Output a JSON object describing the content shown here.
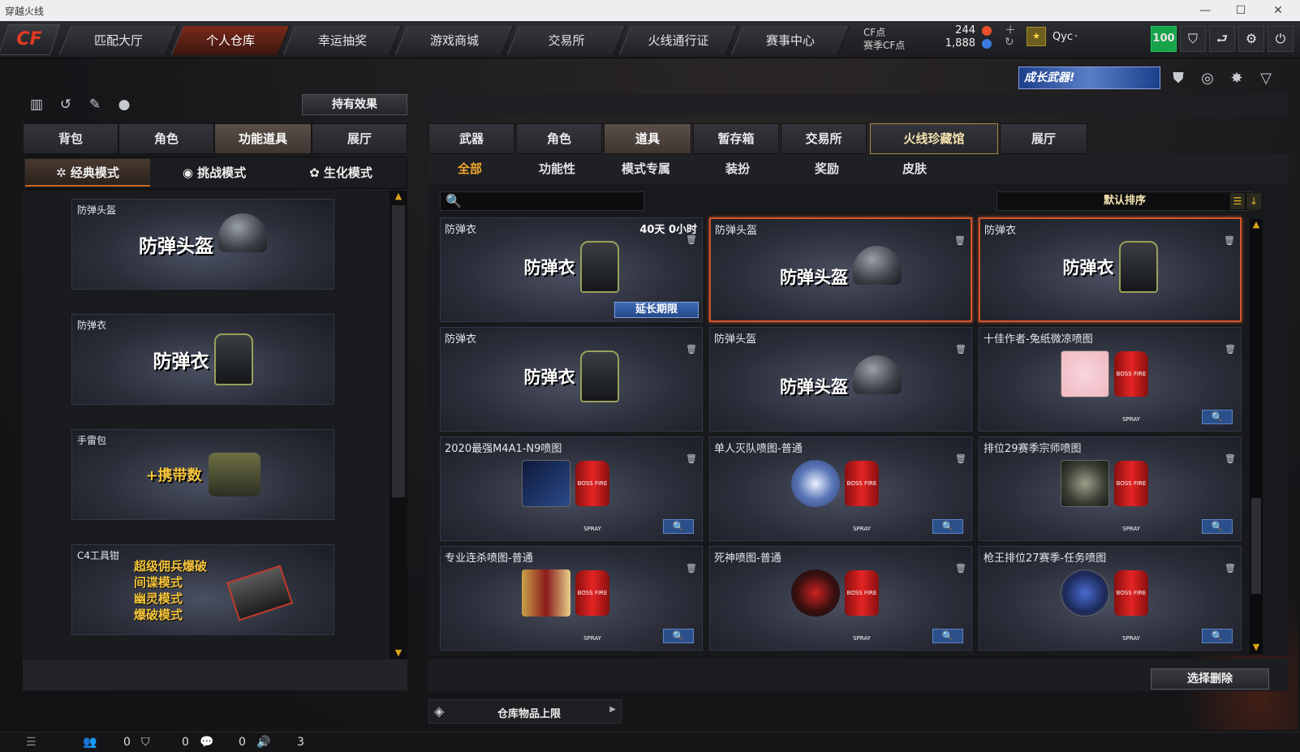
{
  "window": {
    "title": "穿越火线"
  },
  "nav": {
    "logo": "CF",
    "tabs": [
      "匹配大厅",
      "个人仓库",
      "幸运抽奖",
      "游戏商城",
      "交易所",
      "火线通行证",
      "赛事中心"
    ],
    "active_tab": "个人仓库"
  },
  "currency": {
    "cf_label": "CF点",
    "cf_value": "244",
    "season_label": "赛季CF点",
    "season_value": "1,888"
  },
  "user": {
    "name": "Qyc",
    "sep": "·",
    "level_badge": "100"
  },
  "banner": {
    "text": "成长武器!"
  },
  "left": {
    "effect_button": "持有效果",
    "tabs": [
      "背包",
      "角色",
      "功能道具",
      "展厅"
    ],
    "active_tab": "功能道具",
    "modes": [
      "经典模式",
      "挑战模式",
      "生化模式"
    ],
    "active_mode": "经典模式",
    "items": [
      {
        "name": "防弹头盔",
        "label": "防弹头盔"
      },
      {
        "name": "防弹衣",
        "label": "防弹衣"
      },
      {
        "name": "手雷包",
        "label": "+携带数"
      },
      {
        "name": "C4工具钳",
        "label_lines": [
          "超级佣兵爆破",
          "间谍模式",
          "幽灵模式",
          "爆破模式"
        ]
      }
    ]
  },
  "right": {
    "tabs": [
      "武器",
      "角色",
      "道具",
      "暂存箱",
      "交易所",
      "火线珍藏馆",
      "展厅"
    ],
    "active_tab": "道具",
    "subtabs": [
      "全部",
      "功能性",
      "模式专属",
      "装扮",
      "奖励",
      "皮肤"
    ],
    "active_subtab": "全部",
    "sort_label": "默认排序",
    "items": [
      {
        "name": "防弹衣",
        "time": "40天 0小时",
        "label": "防弹衣",
        "extend": "延长期限"
      },
      {
        "name": "防弹头盔",
        "label": "防弹头盔"
      },
      {
        "name": "防弹衣",
        "label": "防弹衣"
      },
      {
        "name": "防弹衣",
        "label": "防弹衣"
      },
      {
        "name": "防弹头盔",
        "label": "防弹头盔"
      },
      {
        "name": "十佳作者-兔纸微凉喷图"
      },
      {
        "name": "2020最强M4A1-N9喷图"
      },
      {
        "name": "单人灭队喷图-普通"
      },
      {
        "name": "排位29赛季宗师喷图"
      },
      {
        "name": "专业连杀喷图-普通"
      },
      {
        "name": "死神喷图-普通"
      },
      {
        "name": "枪王排位27赛季-任务喷图"
      }
    ],
    "can_text": "BOSS FIRE SPRAY",
    "delete_button": "选择删除",
    "capacity_label": "仓库物品上限"
  },
  "status": {
    "v1": "0",
    "v2": "0",
    "v3": "0",
    "v4": "3"
  },
  "colors": {
    "accent": "#f0a631",
    "selected_border": "#d0552a",
    "level_green": "#16a34a"
  }
}
